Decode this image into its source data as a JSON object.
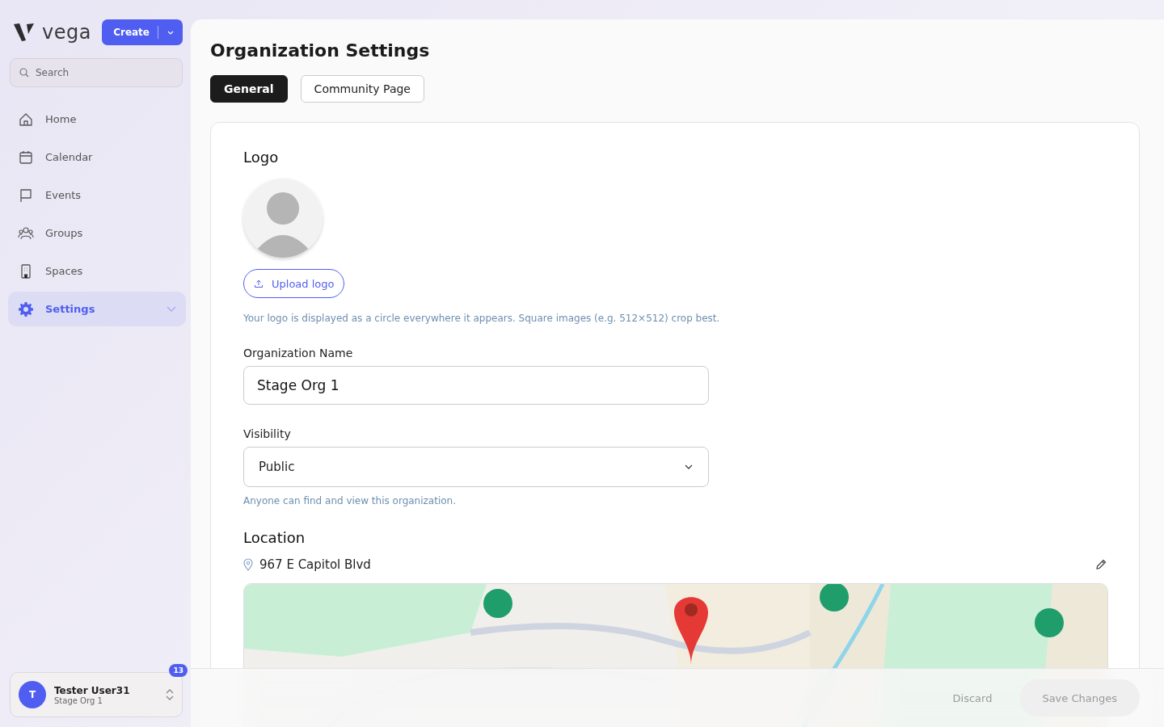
{
  "sidebar": {
    "brand": "vega",
    "create_button": "Create",
    "search": {
      "placeholder": "Search"
    },
    "items": [
      {
        "label": "Home",
        "selected": false
      },
      {
        "label": "Calendar",
        "selected": false
      },
      {
        "label": "Events",
        "selected": false
      },
      {
        "label": "Groups",
        "selected": false
      },
      {
        "label": "Spaces",
        "selected": false
      },
      {
        "label": "Settings",
        "selected": true,
        "expandable": true
      }
    ],
    "user": {
      "initial": "T",
      "name": "Tester User31",
      "org": "Stage Org 1",
      "badge": "13"
    }
  },
  "page": {
    "title": "Organization Settings",
    "tabs": [
      {
        "label": "General",
        "selected": true
      },
      {
        "label": "Community Page",
        "selected": false
      }
    ],
    "logo": {
      "heading": "Logo",
      "upload_button": "Upload logo",
      "hint": "Your logo is displayed as a circle everywhere it appears. Square images (e.g. 512×512) crop best."
    },
    "name_field": {
      "label": "Organization Name",
      "value": "Stage Org 1"
    },
    "visibility": {
      "label": "Visibility",
      "value": "Public",
      "hint": "Anyone can find and view this organization."
    },
    "location": {
      "heading": "Location",
      "address": "967 E Capitol Blvd"
    }
  },
  "footer": {
    "buttons": [
      {
        "label": "Discard",
        "kind": "secondary",
        "disabled": true
      },
      {
        "label": "Save Changes",
        "kind": "primary",
        "disabled": true
      }
    ]
  }
}
